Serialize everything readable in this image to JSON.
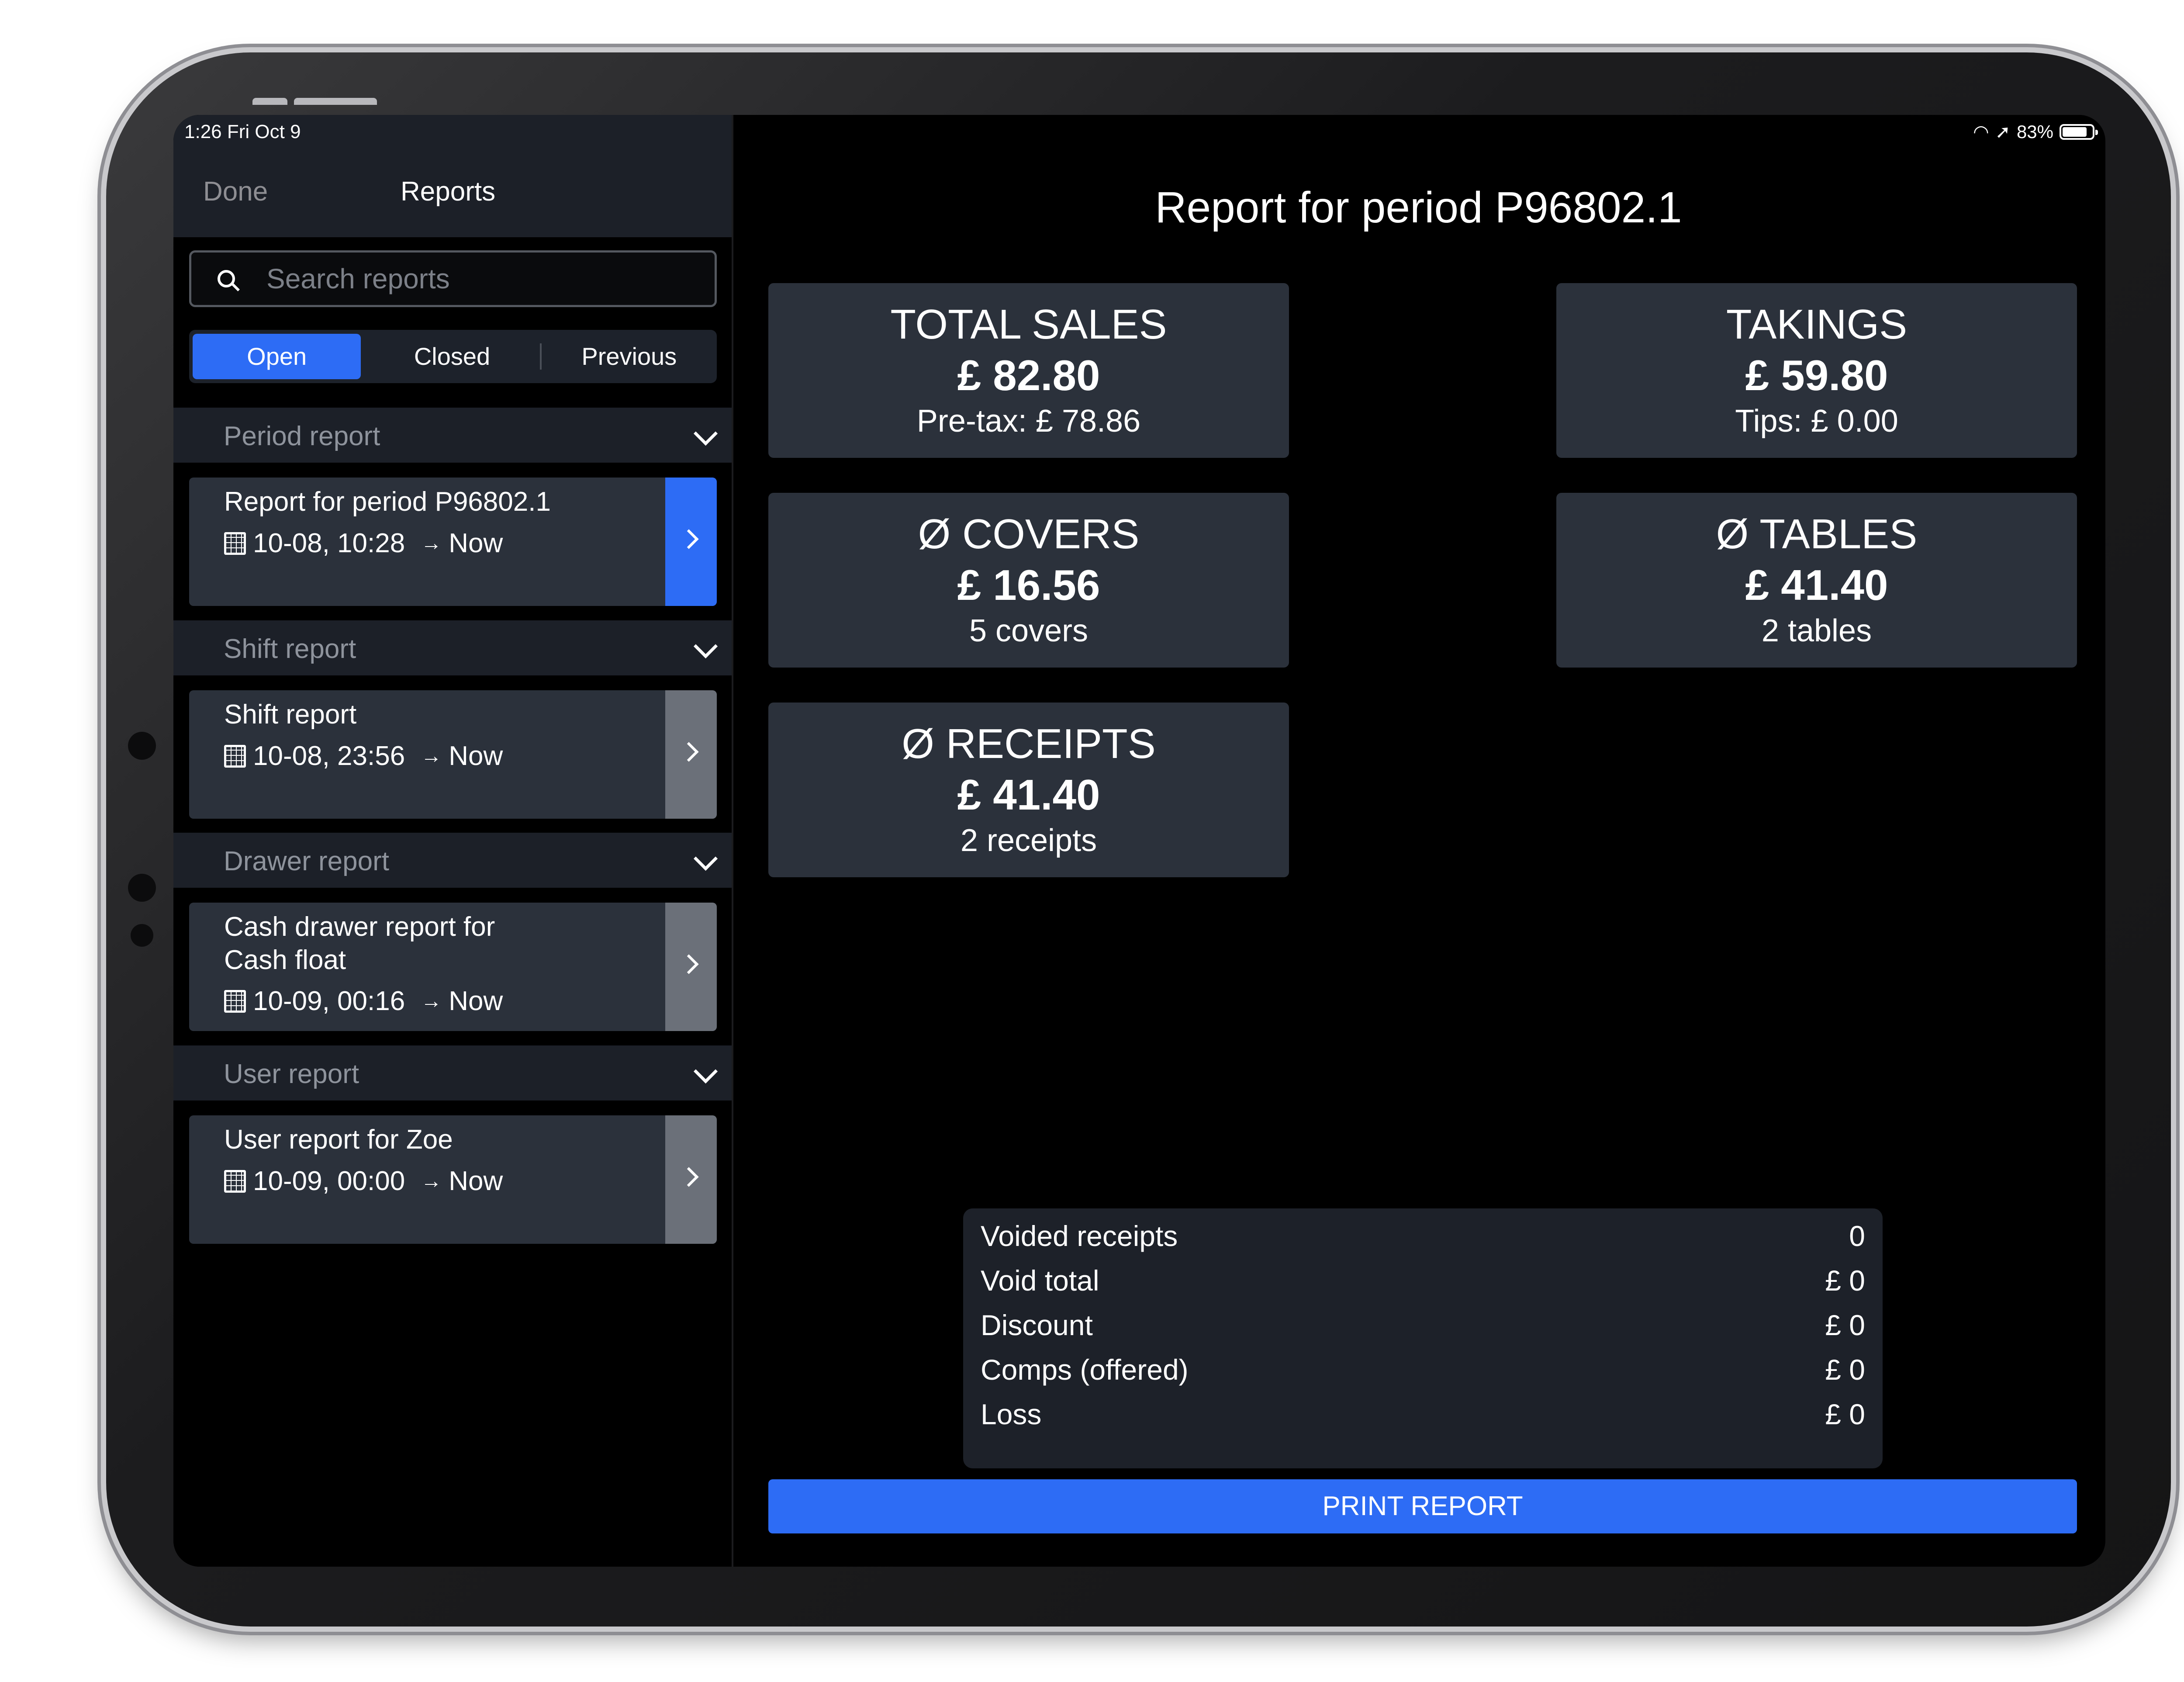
{
  "status_bar": {
    "time": "1:26  Fri Oct 9",
    "battery": "83%",
    "battery_level": 0.83
  },
  "sidebar": {
    "done_label": "Done",
    "title": "Reports",
    "search_placeholder": "Search reports",
    "segments": [
      "Open",
      "Closed",
      "Previous"
    ],
    "active_segment": "Open",
    "sections": [
      {
        "label": "Period report",
        "card": {
          "title": "Report for period P96802.1",
          "date": "10-08, 10:28",
          "end": "Now"
        }
      },
      {
        "label": "Shift report",
        "card": {
          "title": "Shift report",
          "date": "10-08, 23:56",
          "end": "Now"
        }
      },
      {
        "label": "Drawer report",
        "card": {
          "title": "Cash drawer report for Cash float",
          "date": "10-09, 00:16",
          "end": "Now"
        }
      },
      {
        "label": "User report",
        "card": {
          "title": "User report for Zoe",
          "date": "10-09, 00:00",
          "end": "Now"
        }
      }
    ]
  },
  "main": {
    "title": "Report for period P96802.1",
    "tiles": {
      "total_sales": {
        "label": "TOTAL SALES",
        "value": "£ 82.80",
        "sub": "Pre-tax: £ 78.86"
      },
      "takings": {
        "label": "TAKINGS",
        "value": "£ 59.80",
        "sub": "Tips: £ 0.00"
      },
      "covers": {
        "label": "Ø COVERS",
        "value": "£ 16.56",
        "sub": "5 covers"
      },
      "tables": {
        "label": "Ø TABLES",
        "value": "£ 41.40",
        "sub": "2 tables"
      },
      "receipts": {
        "label": "Ø RECEIPTS",
        "value": "£ 41.40",
        "sub": "2 receipts"
      }
    },
    "summary": [
      {
        "label": "Voided receipts",
        "value": "0"
      },
      {
        "label": "Void total",
        "value": "£ 0"
      },
      {
        "label": "Discount",
        "value": "£ 0"
      },
      {
        "label": "Comps (offered)",
        "value": "£ 0"
      },
      {
        "label": "Loss",
        "value": "£ 0"
      }
    ],
    "print_label": "PRINT REPORT"
  },
  "colors": {
    "accent": "#2d6cf5",
    "card": "#2b313b",
    "header": "#1c2028"
  }
}
